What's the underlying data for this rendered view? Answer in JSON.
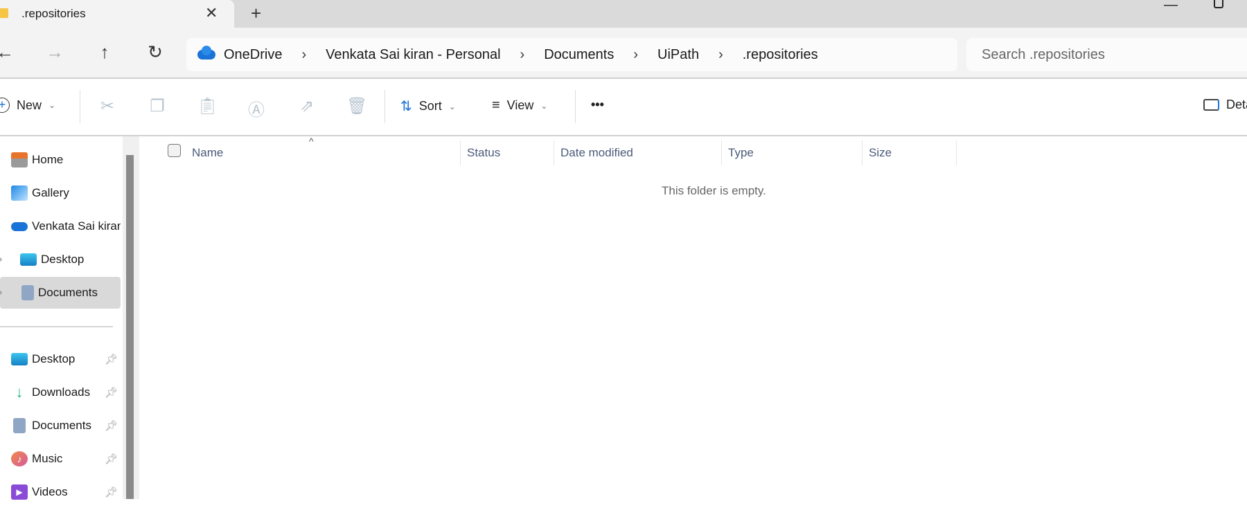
{
  "tab": {
    "title": ".repositories",
    "close": "✕",
    "new_tab": "+"
  },
  "window": {
    "minimize": "—"
  },
  "nav": {
    "back": "←",
    "forward": "→",
    "up": "↑",
    "refresh": "↻"
  },
  "breadcrumb": [
    "OneDrive",
    "Venkata Sai kiran - Personal",
    "Documents",
    "UiPath",
    ".repositories"
  ],
  "breadcrumb_sep": "›",
  "search": {
    "placeholder": "Search .repositories"
  },
  "toolbar": {
    "new": "New",
    "sort": "Sort",
    "view": "View",
    "more": "•••",
    "details": "Details",
    "chev": "⌄"
  },
  "sidebar": {
    "items": [
      {
        "label": "Home"
      },
      {
        "label": "Gallery"
      },
      {
        "label": "Venkata Sai kiran - Personal"
      },
      {
        "label": "Desktop"
      },
      {
        "label": "Documents"
      }
    ],
    "pinned": [
      {
        "label": "Desktop"
      },
      {
        "label": "Downloads"
      },
      {
        "label": "Documents"
      },
      {
        "label": "Music"
      },
      {
        "label": "Videos"
      }
    ]
  },
  "columns": [
    "Name",
    "Status",
    "Date modified",
    "Type",
    "Size"
  ],
  "empty_message": "This folder is empty."
}
